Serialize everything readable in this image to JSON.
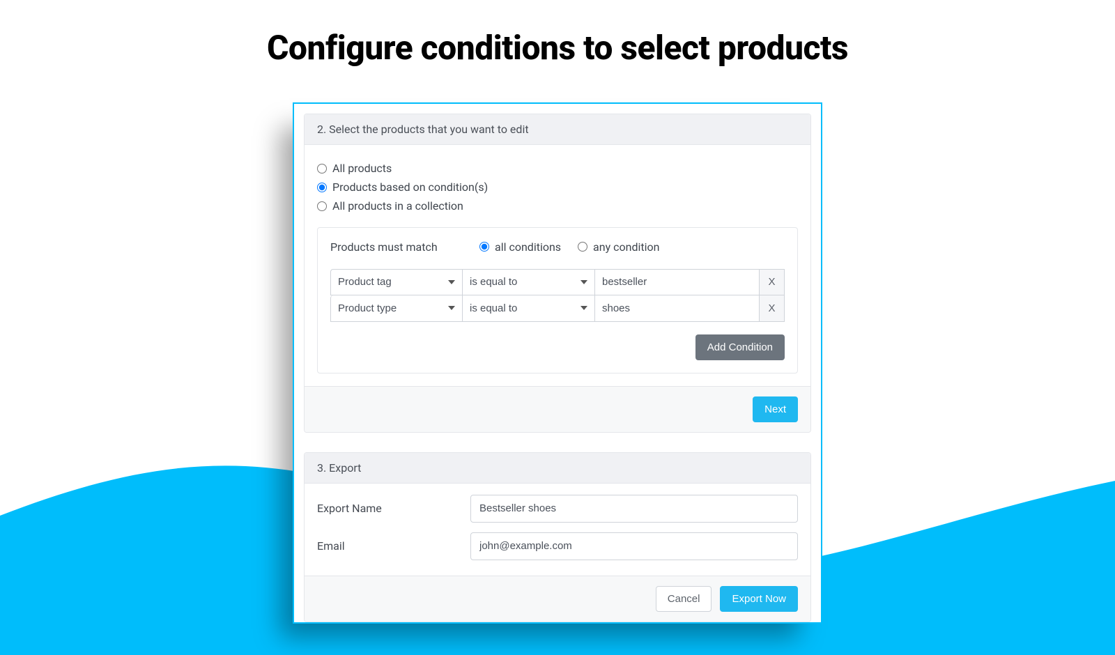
{
  "title": "Configure conditions to select products",
  "step2": {
    "header": "2. Select the products that you want to edit",
    "scope_options": [
      {
        "label": "All products",
        "checked": false
      },
      {
        "label": "Products based on condition(s)",
        "checked": true
      },
      {
        "label": "All products in a collection",
        "checked": false
      }
    ],
    "match_label": "Products must match",
    "match_options": [
      {
        "label": "all conditions",
        "checked": true
      },
      {
        "label": "any condition",
        "checked": false
      }
    ],
    "conditions": [
      {
        "field": "Product tag",
        "operator": "is equal to",
        "value": "bestseller",
        "remove": "X"
      },
      {
        "field": "Product type",
        "operator": "is equal to",
        "value": "shoes",
        "remove": "X"
      }
    ],
    "add_condition": "Add Condition",
    "next": "Next"
  },
  "step3": {
    "header": "3. Export",
    "export_name_label": "Export Name",
    "export_name_value": "Bestseller shoes",
    "email_label": "Email",
    "email_value": "john@example.com",
    "cancel": "Cancel",
    "export_now": "Export Now"
  }
}
